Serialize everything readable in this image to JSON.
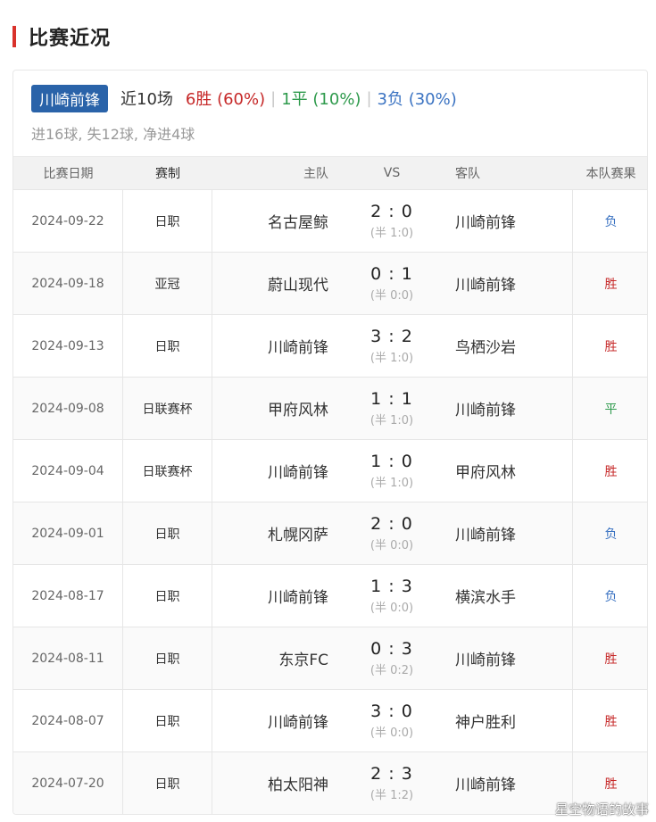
{
  "header": {
    "title": "比赛近况"
  },
  "summary": {
    "team": "川崎前锋",
    "recent": "近10场",
    "wins": "6胜 (60%)",
    "draws": "1平 (10%)",
    "losses": "3负 (30%)",
    "separator": "|",
    "goals": "进16球, 失12球, 净进4球"
  },
  "columns": {
    "date": "比赛日期",
    "comp": "赛制",
    "home": "主队",
    "vs": "VS",
    "away": "客队",
    "result": "本队赛果"
  },
  "matches": [
    {
      "date": "2024-09-22",
      "comp": "日职",
      "home": "名古屋鲸",
      "score": "2 : 0",
      "half": "(半 1:0)",
      "away": "川崎前锋",
      "result": "负"
    },
    {
      "date": "2024-09-18",
      "comp": "亚冠",
      "home": "蔚山现代",
      "score": "0 : 1",
      "half": "(半 0:0)",
      "away": "川崎前锋",
      "result": "胜"
    },
    {
      "date": "2024-09-13",
      "comp": "日职",
      "home": "川崎前锋",
      "score": "3 : 2",
      "half": "(半 1:0)",
      "away": "鸟栖沙岩",
      "result": "胜"
    },
    {
      "date": "2024-09-08",
      "comp": "日联赛杯",
      "home": "甲府风林",
      "score": "1 : 1",
      "half": "(半 1:0)",
      "away": "川崎前锋",
      "result": "平"
    },
    {
      "date": "2024-09-04",
      "comp": "日联赛杯",
      "home": "川崎前锋",
      "score": "1 : 0",
      "half": "(半 1:0)",
      "away": "甲府风林",
      "result": "胜"
    },
    {
      "date": "2024-09-01",
      "comp": "日职",
      "home": "札幌冈萨",
      "score": "2 : 0",
      "half": "(半 0:0)",
      "away": "川崎前锋",
      "result": "负"
    },
    {
      "date": "2024-08-17",
      "comp": "日职",
      "home": "川崎前锋",
      "score": "1 : 3",
      "half": "(半 0:0)",
      "away": "横滨水手",
      "result": "负"
    },
    {
      "date": "2024-08-11",
      "comp": "日职",
      "home": "东京FC",
      "score": "0 : 3",
      "half": "(半 0:2)",
      "away": "川崎前锋",
      "result": "胜"
    },
    {
      "date": "2024-08-07",
      "comp": "日职",
      "home": "川崎前锋",
      "score": "3 : 0",
      "half": "(半 0:0)",
      "away": "神户胜利",
      "result": "胜"
    },
    {
      "date": "2024-07-20",
      "comp": "日职",
      "home": "柏太阳神",
      "score": "2 : 3",
      "half": "(半 1:2)",
      "away": "川崎前锋",
      "result": "胜"
    }
  ],
  "colors": {
    "accent": "#d9322b",
    "badge": "#2a63a9",
    "win": "#c62828",
    "draw": "#2e9a4c",
    "loss": "#3b73c2"
  },
  "watermark": "星空物语的故事"
}
